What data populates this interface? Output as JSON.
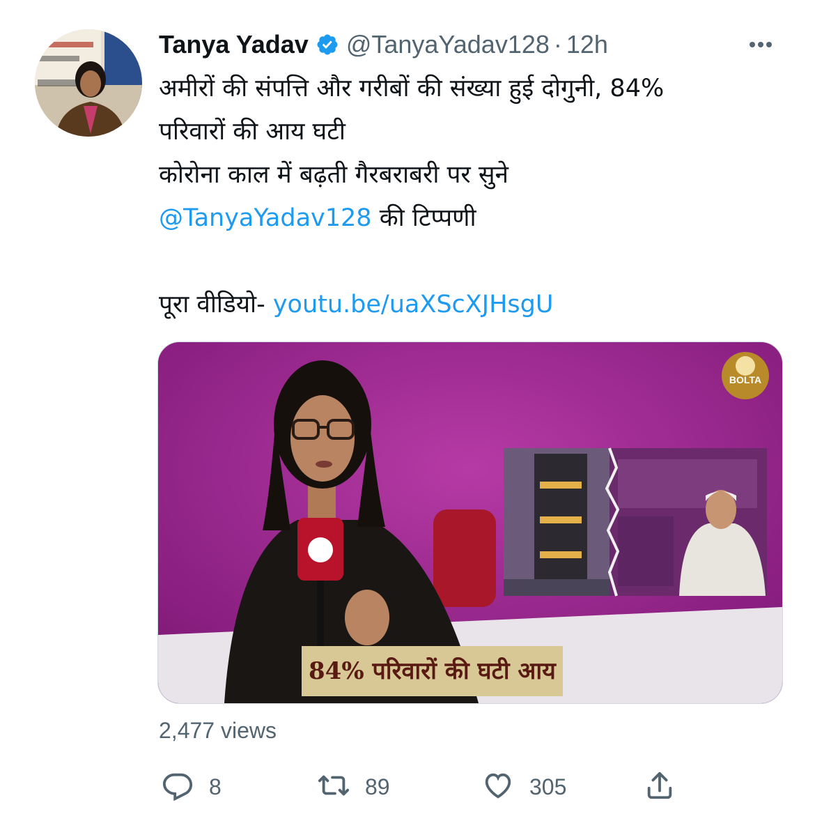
{
  "author": {
    "name": "Tanya Yadav",
    "handle": "@TanyaYadav128",
    "separator": "·",
    "time": "12h",
    "verified": true
  },
  "tweet": {
    "lines": [
      "अमीरों की संपत्ति और गरीबों की संख्या हुई दोगुनी, 84%",
      "परिवारों की आय घटी",
      "कोरोना काल में बढ़ती गैरबराबरी पर सुने"
    ],
    "mention": "@TanyaYadav128",
    "mention_suffix": " की टिप्पणी",
    "video_prefix": "पूरा वीडियो- ",
    "video_link": "youtu.be/uaXScXJHsgU"
  },
  "media": {
    "caption": "84% परिवारों की घटी आय",
    "logo_text": "BOLTA"
  },
  "views": "2,477 views",
  "actions": {
    "replies": "8",
    "retweets": "89",
    "likes": "305"
  },
  "icons": {
    "verified": "verified-badge-icon",
    "more": "more-options-icon",
    "reply": "reply-icon",
    "retweet": "retweet-icon",
    "like": "heart-icon",
    "share": "share-icon"
  },
  "colors": {
    "link": "#1d9bf0",
    "muted": "#536471",
    "text": "#0f1419",
    "media_background": "#8e1d86"
  }
}
